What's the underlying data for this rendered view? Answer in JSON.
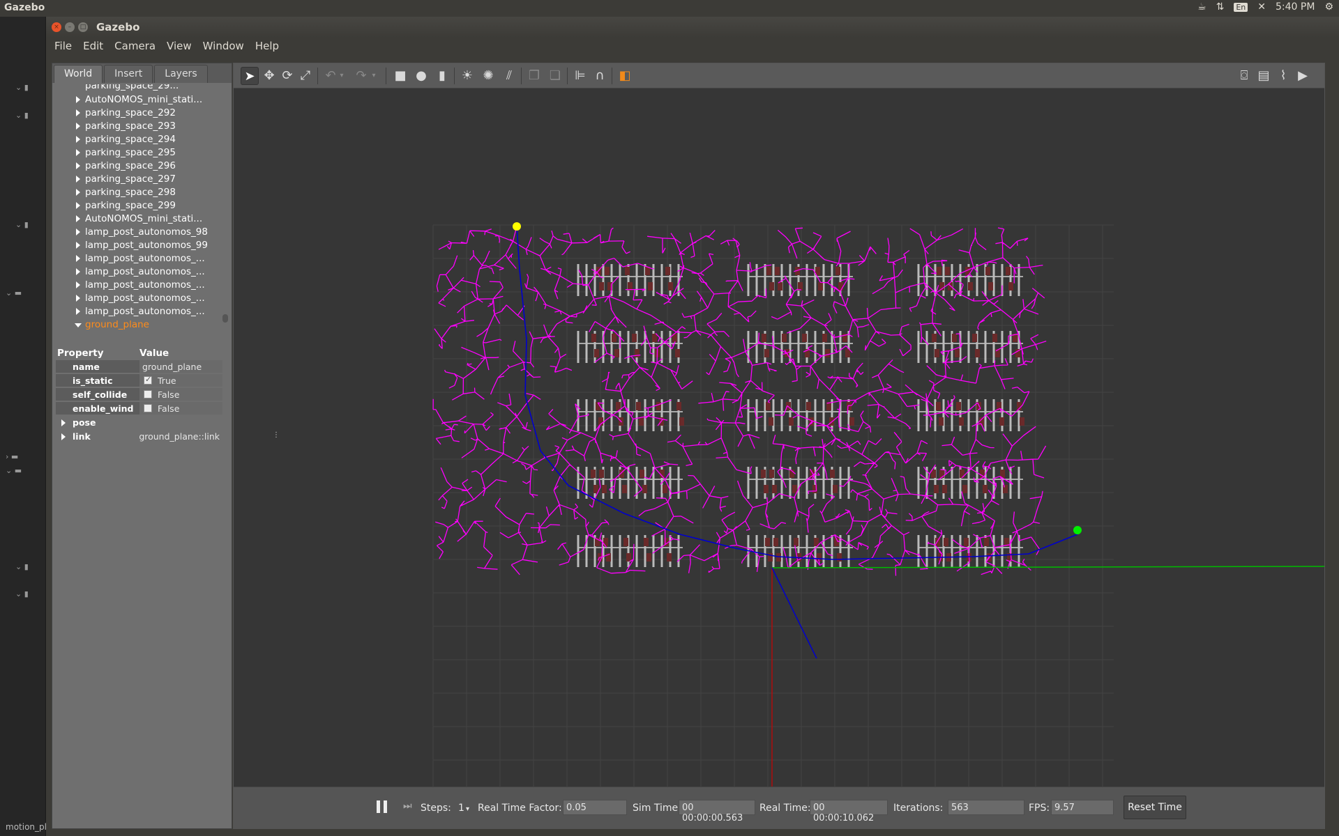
{
  "topbar": {
    "app": "Gazebo",
    "lang": "En",
    "time": "5:40 PM"
  },
  "launcher": {
    "bottom_label": "motion_pl"
  },
  "window": {
    "title": "Gazebo"
  },
  "menu": [
    "File",
    "Edit",
    "Camera",
    "View",
    "Window",
    "Help"
  ],
  "tabs": [
    "World",
    "Insert",
    "Layers"
  ],
  "tree": {
    "partial_top": "parking_space_29...",
    "items": [
      "AutoNOMOS_mini_stati...",
      "parking_space_292",
      "parking_space_293",
      "parking_space_294",
      "parking_space_295",
      "parking_space_296",
      "parking_space_297",
      "parking_space_298",
      "parking_space_299",
      "AutoNOMOS_mini_stati...",
      "lamp_post_autonomos_98",
      "lamp_post_autonomos_99",
      "lamp_post_autonomos_...",
      "lamp_post_autonomos_...",
      "lamp_post_autonomos_...",
      "lamp_post_autonomos_...",
      "lamp_post_autonomos_..."
    ],
    "selected": "ground_plane"
  },
  "props": {
    "header_key": "Property",
    "header_value": "Value",
    "name_key": "name",
    "name_value": "ground_plane",
    "is_static_key": "is_static",
    "is_static_value": "True",
    "self_collide_key": "self_collide",
    "self_collide_value": "False",
    "enable_wind_key": "enable_wind",
    "enable_wind_value": "False",
    "pose_key": "pose",
    "link_key": "link",
    "link_value": "ground_plane::link"
  },
  "bottom": {
    "steps_label": "Steps:",
    "steps_value": "1",
    "rtf_label": "Real Time Factor:",
    "rtf_value": "0.05",
    "simtime_label": "Sim Time:",
    "simtime_value": "00 00:00:00.563",
    "realtime_label": "Real Time:",
    "realtime_value": "00 00:00:10.062",
    "iter_label": "Iterations:",
    "iter_value": "563",
    "fps_label": "FPS:",
    "fps_value": "9.57",
    "reset_label": "Reset Time"
  },
  "scene": {
    "tree_color": "#ff00ff",
    "path_color": "#0000cc",
    "start_color": "#ffff00",
    "goal_color": "#00ee00",
    "axis_x_color": "#00bb00",
    "axis_y_color": "#cc0000",
    "parking_rows": 5,
    "parking_cols": 3
  },
  "icons": {
    "tools": [
      "select-arrow-icon",
      "translate-icon",
      "rotate-icon",
      "scale-icon",
      "undo-icon",
      "redo-icon",
      "box-icon",
      "sphere-icon",
      "cylinder-icon",
      "point-light-icon",
      "spot-light-icon",
      "directional-light-icon",
      "copy-icon",
      "paste-icon",
      "align-icon",
      "snap-icon",
      "view-angle-icon",
      "screenshot-icon",
      "log-icon",
      "plot-icon",
      "video-icon"
    ]
  }
}
